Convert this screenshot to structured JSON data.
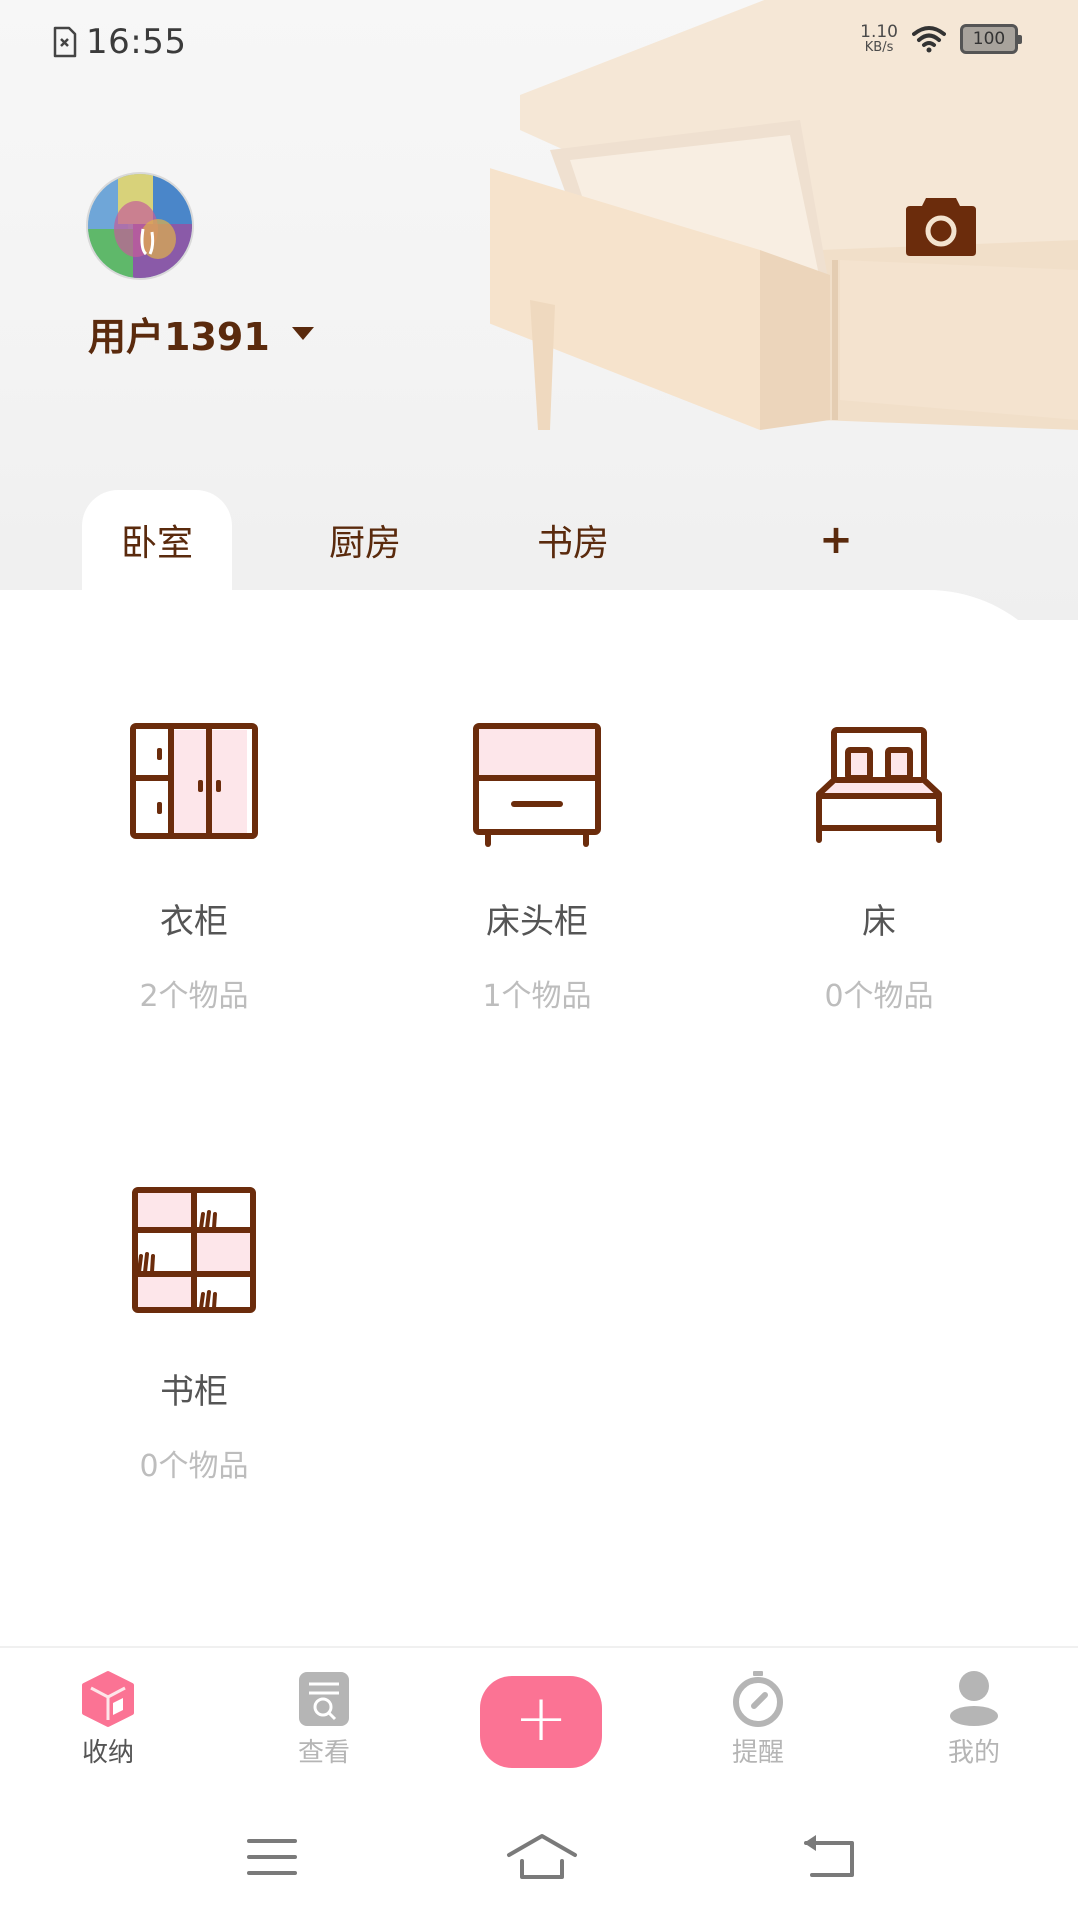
{
  "status_bar": {
    "time": "16:55",
    "sim_icon": "no-sim-icon",
    "net_speed_value": "1.10",
    "net_speed_unit": "KB/s",
    "wifi_icon": "wifi-icon",
    "battery": "100"
  },
  "header": {
    "user_name": "用户1391",
    "avatar_icon": "avatar-image",
    "dropdown_icon": "caret-down-icon",
    "camera_icon": "camera-icon"
  },
  "rooms": {
    "tabs": [
      {
        "label": "卧室",
        "active": true
      },
      {
        "label": "厨房",
        "active": false
      },
      {
        "label": "书房",
        "active": false
      }
    ],
    "add_label": "+"
  },
  "furniture": [
    {
      "name": "衣柜",
      "count": "2个物品",
      "icon": "wardrobe-icon"
    },
    {
      "name": "床头柜",
      "count": "1个物品",
      "icon": "nightstand-icon"
    },
    {
      "name": "床",
      "count": "0个物品",
      "icon": "bed-icon"
    },
    {
      "name": "书柜",
      "count": "0个物品",
      "icon": "bookshelf-icon"
    }
  ],
  "bottom_nav": {
    "items": [
      {
        "label": "收纳",
        "icon": "box-icon",
        "active": true
      },
      {
        "label": "查看",
        "icon": "search-list-icon",
        "active": false
      },
      {
        "label": "提醒",
        "icon": "timer-icon",
        "active": false
      },
      {
        "label": "我的",
        "icon": "user-icon",
        "active": false
      }
    ],
    "fab_label": "+"
  },
  "system_nav": {
    "menu_icon": "menu-icon",
    "home_icon": "home-icon",
    "back_icon": "back-icon"
  },
  "colors": {
    "brand_brown": "#5a2a0d",
    "accent_pink": "#fb7394",
    "light_pink": "#fde6ea",
    "inactive_gray": "#b5b5b5"
  }
}
